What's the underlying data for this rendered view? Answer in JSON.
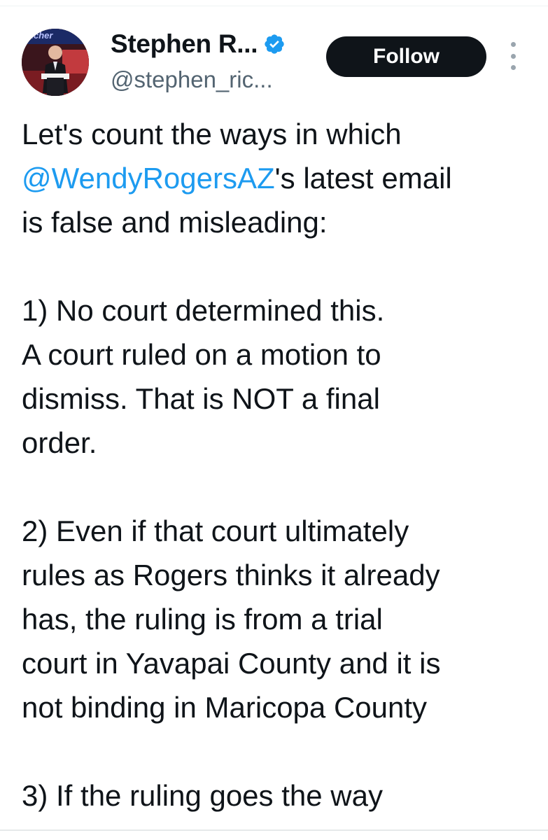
{
  "author": {
    "display_name": "Stephen R...",
    "handle": "@stephen_ric...",
    "avatar_banner_text": "Richer",
    "verified": true
  },
  "actions": {
    "follow_label": "Follow",
    "more_icon": "more-vertical-icon"
  },
  "tweet": {
    "intro_line1": "Let's count the ways in which",
    "mention": "@WendyRogersAZ",
    "intro_line2_rest": "'s latest email",
    "intro_line3": "is false and misleading:",
    "point1_lines": [
      "1) No court determined this.",
      "A court ruled on a motion to",
      "dismiss.  That is NOT a final",
      "order."
    ],
    "point2_lines": [
      "2) Even if that court ultimately",
      "rules as Rogers thinks it already",
      "has, the ruling is from a trial",
      "court in Yavapai County and it is",
      "not binding in Maricopa County"
    ],
    "point3_lines": [
      "3) If the ruling goes the way"
    ]
  },
  "colors": {
    "text": "#0f1419",
    "secondary": "#536471",
    "mention": "#1d9bf0",
    "follow_bg": "#0f1419",
    "verified": "#1d9bf0"
  }
}
